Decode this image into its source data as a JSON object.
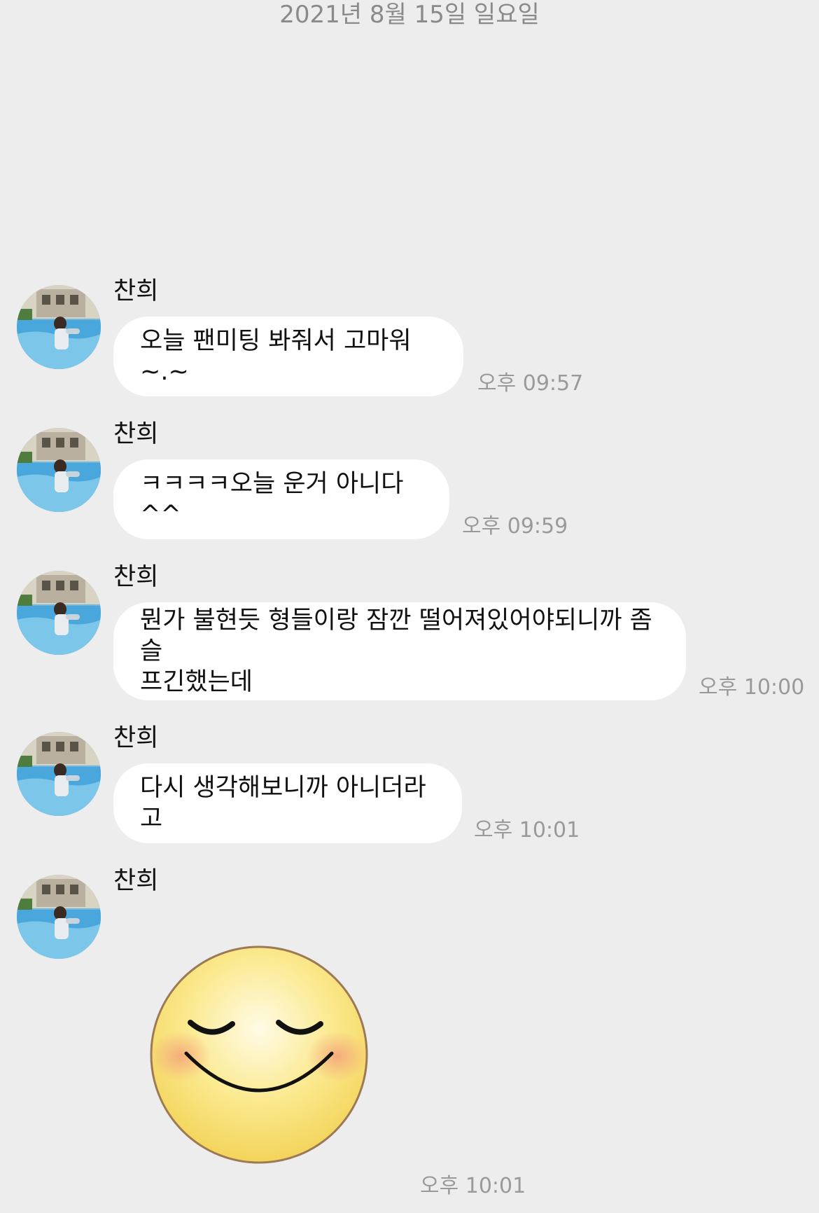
{
  "chat": {
    "date": "2021년 8월 15일 일요일",
    "messages": [
      {
        "sender": "찬희",
        "text": "오늘 팬미팅 봐줘서 고마워~.~",
        "time": "오후 09:57"
      },
      {
        "sender": "찬희",
        "text": "ㅋㅋㅋㅋ오늘 운거 아니다^^",
        "time": "오후 09:59"
      },
      {
        "sender": "찬희",
        "text": "뭔가 불현듯 형들이랑 잠깐 떨어져있어야되니까 좀 슬\n프긴했는데",
        "time": "오후 10:00"
      },
      {
        "sender": "찬희",
        "text": "다시 생각해보니까 아니더라고",
        "time": "오후 10:01"
      },
      {
        "sender": "찬희",
        "sticker": "smiling-face-sticker",
        "time": "오후 10:01"
      }
    ]
  },
  "colors": {
    "background": "#ededed",
    "bubble": "#ffffff",
    "timestamp": "#9a9a9a",
    "date_header": "#8a8a8a"
  }
}
